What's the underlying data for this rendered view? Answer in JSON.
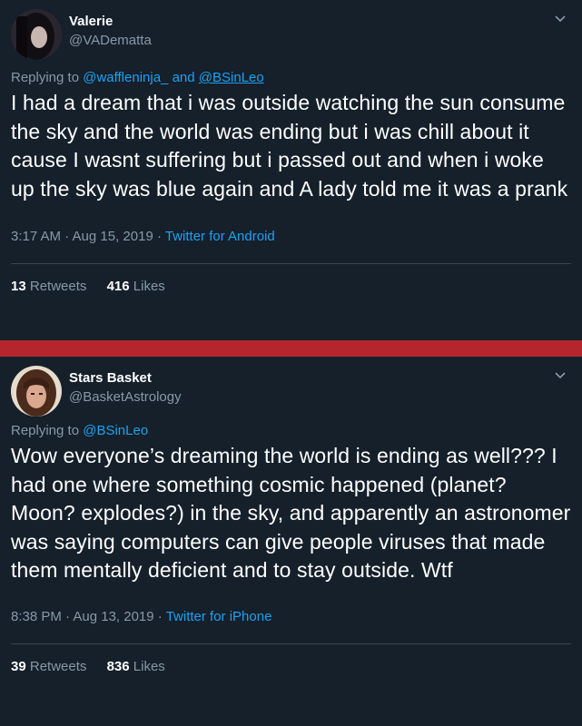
{
  "tweets": [
    {
      "display_name": "Valerie",
      "handle": "@VADematta",
      "replying_prefix": "Replying to",
      "replying_to": [
        "@waffleninja_",
        "@BSinLeo"
      ],
      "replying_joiner": "and",
      "text": "I had a dream that i was outside watching the sun consume the sky and the world was ending but i was chill about it cause I wasnt suffering but i passed out and when i woke up the sky was blue again and A lady told me it was a prank",
      "time": "3:17 AM · Aug 15, 2019 ·",
      "source": "Twitter for Android",
      "retweets_count": "13",
      "retweets_label": "Retweets",
      "likes_count": "416",
      "likes_label": "Likes"
    },
    {
      "display_name": "Stars Basket",
      "handle": "@BasketAstrology",
      "replying_prefix": "Replying to",
      "replying_to": [
        "@BSinLeo"
      ],
      "text": "Wow everyone’s dreaming the world is ending as well??? I had one where something cosmic happened (planet? Moon? explodes?) in the sky, and apparently an astronomer was saying computers can give people viruses that made them mentally deficient and to stay outside. Wtf",
      "time": "8:38 PM · Aug 13, 2019 ·",
      "source": "Twitter for iPhone",
      "retweets_count": "39",
      "retweets_label": "Retweets",
      "likes_count": "836",
      "likes_label": "Likes"
    }
  ],
  "colors": {
    "background": "#15202b",
    "secondary_text": "#8899a6",
    "link": "#1da1f2",
    "divider_band": "#b5262c"
  },
  "icons": [
    "chevron-down-icon",
    "avatar"
  ]
}
